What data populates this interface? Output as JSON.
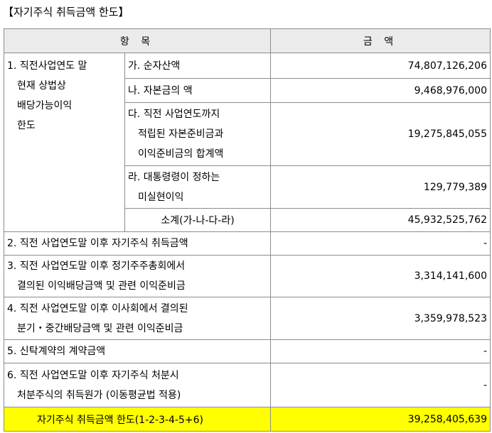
{
  "title": "【자기주식 취득금액 한도】",
  "header": {
    "item": "항 목",
    "amount": "금 액"
  },
  "section1": {
    "label_lines": [
      "1. 직전사업연도 말",
      "현재 상법상",
      "배당가능이익",
      "한도"
    ],
    "rows": [
      {
        "lines": [
          "가. 순자산액"
        ],
        "amount": "74,807,126,206"
      },
      {
        "lines": [
          "나. 자본금의 액"
        ],
        "amount": "9,468,976,000"
      },
      {
        "lines": [
          "다. 직전 사업연도까지",
          "적립된 자본준비금과",
          "이익준비금의 합계액"
        ],
        "amount": "19,275,845,055"
      },
      {
        "lines": [
          "라. 대통령령이 정하는",
          "미실현이익"
        ],
        "amount": "129,779,389"
      }
    ],
    "subtotal": {
      "label": "소계(가-나-다-라)",
      "amount": "45,932,525,762"
    }
  },
  "row2": {
    "lines": [
      "2. 직전 사업연도말 이후 자기주식 취득금액"
    ],
    "amount": "-"
  },
  "row3": {
    "lines": [
      "3. 직전 사업연도말 이후 정기주주총회에서",
      "결의된 이익배당금액 및 관련 이익준비금"
    ],
    "amount": "3,314,141,600"
  },
  "row4": {
    "lines": [
      "4. 직전 사업연도말 이후 이사회에서 결의된",
      "분기・중간배당금액 및 관련 이익준비금"
    ],
    "amount": "3,359,978,523"
  },
  "row5": {
    "lines": [
      "5. 신탁계약의 계약금액"
    ],
    "amount": "-"
  },
  "row6": {
    "lines": [
      "6. 직전 사업연도말 이후 자기주식 처분시",
      "처분주식의 취득원가 (이동평균법 적용)"
    ],
    "amount": "-"
  },
  "total": {
    "label": "자기주식 취득금액 한도(1-2-3-4-5+6)",
    "amount": "39,258,405,639"
  },
  "colors": {
    "header_bg": "#ebebeb",
    "highlight": "#ffff00",
    "border": "#8c8c8c"
  }
}
